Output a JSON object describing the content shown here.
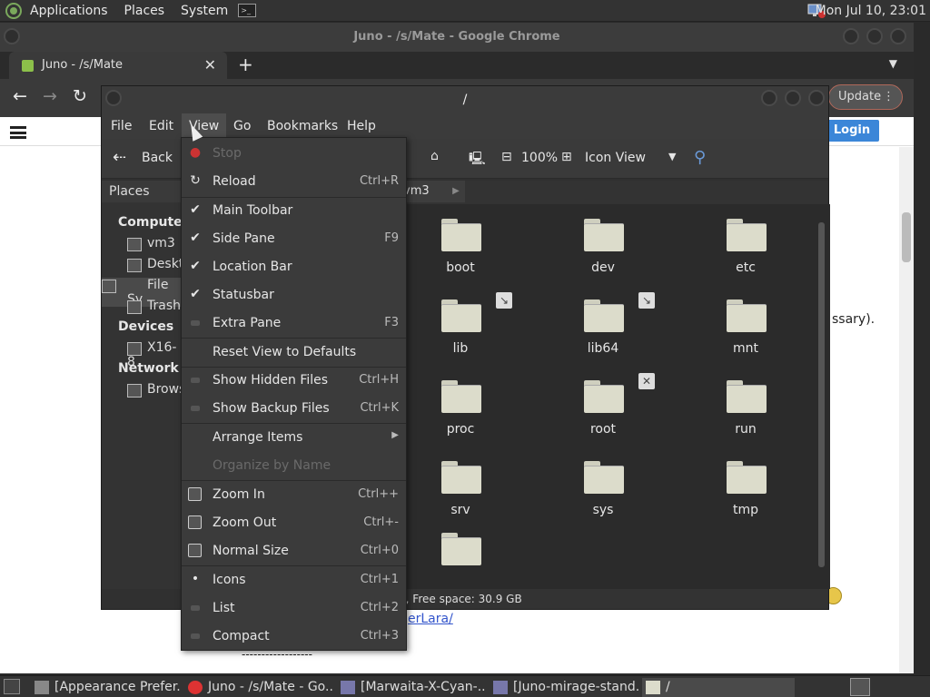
{
  "topbar": {
    "menus": [
      "Applications",
      "Places",
      "System"
    ],
    "clock": "Mon Jul 10, 23:01"
  },
  "chrome": {
    "window_title": "Juno - /s/Mate - Google Chrome",
    "tab_title": "Juno - /s/Mate",
    "update_label": "Update",
    "login_label": "Login",
    "page_text_right": "ssary).",
    "page_link": "erLara/",
    "page_dashes": "------------------"
  },
  "caja": {
    "window_title": "/",
    "menus": [
      "File",
      "Edit",
      "View",
      "Go",
      "Bookmarks",
      "Help"
    ],
    "toolbar": {
      "back": "Back",
      "zoom": "100%",
      "view_mode": "Icon View"
    },
    "places_header": "Places",
    "sidebar": {
      "sections": [
        {
          "title": "Computer",
          "items": [
            "vm3",
            "Deskt",
            "File Sy",
            "Trash"
          ]
        },
        {
          "title": "Devices",
          "items": [
            "X16-8"
          ]
        },
        {
          "title": "Network",
          "items": [
            "Brows"
          ]
        }
      ]
    },
    "location_crumb": "vm3",
    "folders": [
      "boot",
      "dev",
      "etc",
      "lib",
      "lib64",
      "mnt",
      "proc",
      "root",
      "run",
      "srv",
      "sys",
      "tmp",
      ""
    ],
    "status": "), Free space: 30.9 GB"
  },
  "view_menu": {
    "items": [
      {
        "label": "Stop",
        "accel": ""
      },
      {
        "label": "Reload",
        "accel": "Ctrl+R"
      },
      {
        "label": "Main Toolbar",
        "accel": ""
      },
      {
        "label": "Side Pane",
        "accel": "F9"
      },
      {
        "label": "Location Bar",
        "accel": ""
      },
      {
        "label": "Statusbar",
        "accel": ""
      },
      {
        "label": "Extra Pane",
        "accel": "F3"
      },
      {
        "label": "Reset View to Defaults",
        "accel": ""
      },
      {
        "label": "Show Hidden Files",
        "accel": "Ctrl+H"
      },
      {
        "label": "Show Backup Files",
        "accel": "Ctrl+K"
      },
      {
        "label": "Arrange Items",
        "accel": ""
      },
      {
        "label": "Organize by Name",
        "accel": ""
      },
      {
        "label": "Zoom In",
        "accel": "Ctrl++"
      },
      {
        "label": "Zoom Out",
        "accel": "Ctrl+-"
      },
      {
        "label": "Normal Size",
        "accel": "Ctrl+0"
      },
      {
        "label": "Icons",
        "accel": "Ctrl+1"
      },
      {
        "label": "List",
        "accel": "Ctrl+2"
      },
      {
        "label": "Compact",
        "accel": "Ctrl+3"
      }
    ]
  },
  "taskbar": {
    "tasks": [
      "[Appearance Prefer...",
      "Juno - /s/Mate - Go...",
      "[Marwaita-X-Cyan-...",
      "[Juno-mirage-stand...",
      "/"
    ]
  }
}
